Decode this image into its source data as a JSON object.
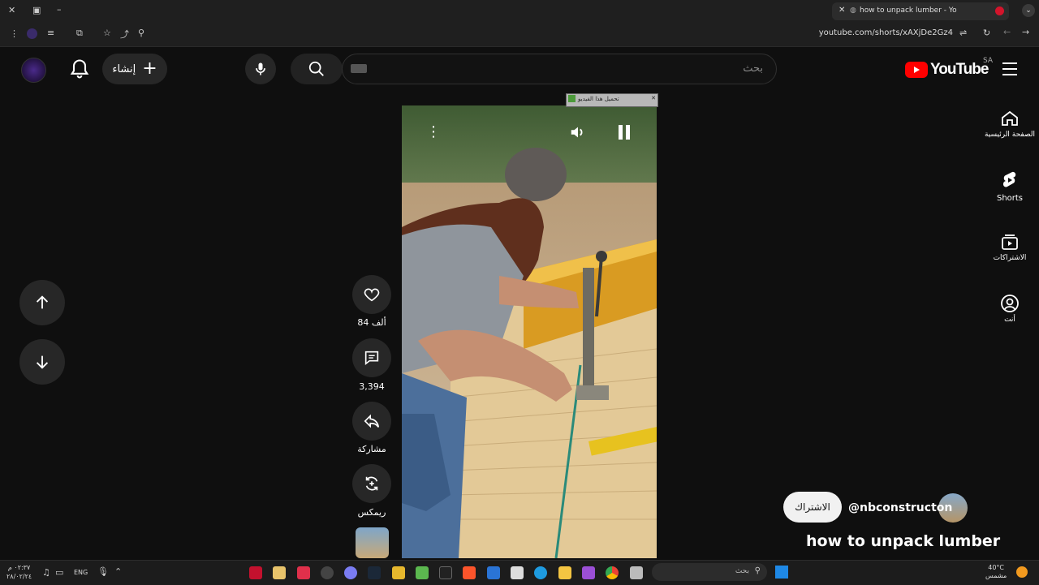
{
  "browser": {
    "tab_title": "how to unpack lumber - Yo",
    "url": "youtube.com/shorts/xAXjDe2Gz4"
  },
  "header": {
    "logo_text": "YouTube",
    "region": "SA",
    "search_placeholder": "بحث",
    "create_label": "إنشاء"
  },
  "sidebar": {
    "items": [
      {
        "label": "الصفحة الرئيسية",
        "icon": "home-icon"
      },
      {
        "label": "Shorts",
        "icon": "shorts-icon"
      },
      {
        "label": "الاشتراكات",
        "icon": "subscriptions-icon"
      },
      {
        "label": "أنت",
        "icon": "user-icon"
      }
    ]
  },
  "actions": {
    "likes": "84 ألف",
    "comments": "3,394",
    "share": "مشاركة",
    "remix": "ريمكس"
  },
  "video": {
    "ad_bar_text": "تحميل هذا الفيديو"
  },
  "channel": {
    "handle": "@nbconstructon",
    "subscribe": "الاشتراك",
    "title": "how to unpack lumber"
  },
  "taskbar": {
    "time": "٠٢:٣٧ م",
    "date": "٢٨/٠٢/٢٤",
    "lang": "ENG",
    "search": "بحث",
    "temp": "40°C",
    "weather": "مشمس"
  },
  "colors": {
    "brand_red": "#ff0000",
    "bg": "#0f0f0f"
  }
}
